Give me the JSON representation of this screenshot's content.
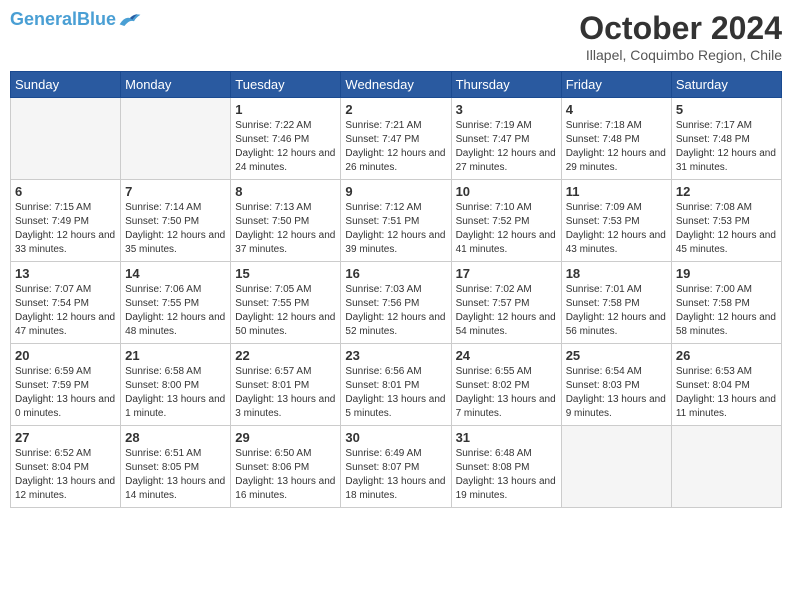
{
  "header": {
    "logo_line1": "General",
    "logo_line2": "Blue",
    "month_year": "October 2024",
    "location": "Illapel, Coquimbo Region, Chile"
  },
  "days_of_week": [
    "Sunday",
    "Monday",
    "Tuesday",
    "Wednesday",
    "Thursday",
    "Friday",
    "Saturday"
  ],
  "weeks": [
    [
      {
        "day": "",
        "empty": true
      },
      {
        "day": "",
        "empty": true
      },
      {
        "day": "1",
        "sunrise": "7:22 AM",
        "sunset": "7:46 PM",
        "daylight": "12 hours and 24 minutes."
      },
      {
        "day": "2",
        "sunrise": "7:21 AM",
        "sunset": "7:47 PM",
        "daylight": "12 hours and 26 minutes."
      },
      {
        "day": "3",
        "sunrise": "7:19 AM",
        "sunset": "7:47 PM",
        "daylight": "12 hours and 27 minutes."
      },
      {
        "day": "4",
        "sunrise": "7:18 AM",
        "sunset": "7:48 PM",
        "daylight": "12 hours and 29 minutes."
      },
      {
        "day": "5",
        "sunrise": "7:17 AM",
        "sunset": "7:48 PM",
        "daylight": "12 hours and 31 minutes."
      }
    ],
    [
      {
        "day": "6",
        "sunrise": "7:15 AM",
        "sunset": "7:49 PM",
        "daylight": "12 hours and 33 minutes."
      },
      {
        "day": "7",
        "sunrise": "7:14 AM",
        "sunset": "7:50 PM",
        "daylight": "12 hours and 35 minutes."
      },
      {
        "day": "8",
        "sunrise": "7:13 AM",
        "sunset": "7:50 PM",
        "daylight": "12 hours and 37 minutes."
      },
      {
        "day": "9",
        "sunrise": "7:12 AM",
        "sunset": "7:51 PM",
        "daylight": "12 hours and 39 minutes."
      },
      {
        "day": "10",
        "sunrise": "7:10 AM",
        "sunset": "7:52 PM",
        "daylight": "12 hours and 41 minutes."
      },
      {
        "day": "11",
        "sunrise": "7:09 AM",
        "sunset": "7:53 PM",
        "daylight": "12 hours and 43 minutes."
      },
      {
        "day": "12",
        "sunrise": "7:08 AM",
        "sunset": "7:53 PM",
        "daylight": "12 hours and 45 minutes."
      }
    ],
    [
      {
        "day": "13",
        "sunrise": "7:07 AM",
        "sunset": "7:54 PM",
        "daylight": "12 hours and 47 minutes."
      },
      {
        "day": "14",
        "sunrise": "7:06 AM",
        "sunset": "7:55 PM",
        "daylight": "12 hours and 48 minutes."
      },
      {
        "day": "15",
        "sunrise": "7:05 AM",
        "sunset": "7:55 PM",
        "daylight": "12 hours and 50 minutes."
      },
      {
        "day": "16",
        "sunrise": "7:03 AM",
        "sunset": "7:56 PM",
        "daylight": "12 hours and 52 minutes."
      },
      {
        "day": "17",
        "sunrise": "7:02 AM",
        "sunset": "7:57 PM",
        "daylight": "12 hours and 54 minutes."
      },
      {
        "day": "18",
        "sunrise": "7:01 AM",
        "sunset": "7:58 PM",
        "daylight": "12 hours and 56 minutes."
      },
      {
        "day": "19",
        "sunrise": "7:00 AM",
        "sunset": "7:58 PM",
        "daylight": "12 hours and 58 minutes."
      }
    ],
    [
      {
        "day": "20",
        "sunrise": "6:59 AM",
        "sunset": "7:59 PM",
        "daylight": "13 hours and 0 minutes."
      },
      {
        "day": "21",
        "sunrise": "6:58 AM",
        "sunset": "8:00 PM",
        "daylight": "13 hours and 1 minute."
      },
      {
        "day": "22",
        "sunrise": "6:57 AM",
        "sunset": "8:01 PM",
        "daylight": "13 hours and 3 minutes."
      },
      {
        "day": "23",
        "sunrise": "6:56 AM",
        "sunset": "8:01 PM",
        "daylight": "13 hours and 5 minutes."
      },
      {
        "day": "24",
        "sunrise": "6:55 AM",
        "sunset": "8:02 PM",
        "daylight": "13 hours and 7 minutes."
      },
      {
        "day": "25",
        "sunrise": "6:54 AM",
        "sunset": "8:03 PM",
        "daylight": "13 hours and 9 minutes."
      },
      {
        "day": "26",
        "sunrise": "6:53 AM",
        "sunset": "8:04 PM",
        "daylight": "13 hours and 11 minutes."
      }
    ],
    [
      {
        "day": "27",
        "sunrise": "6:52 AM",
        "sunset": "8:04 PM",
        "daylight": "13 hours and 12 minutes."
      },
      {
        "day": "28",
        "sunrise": "6:51 AM",
        "sunset": "8:05 PM",
        "daylight": "13 hours and 14 minutes."
      },
      {
        "day": "29",
        "sunrise": "6:50 AM",
        "sunset": "8:06 PM",
        "daylight": "13 hours and 16 minutes."
      },
      {
        "day": "30",
        "sunrise": "6:49 AM",
        "sunset": "8:07 PM",
        "daylight": "13 hours and 18 minutes."
      },
      {
        "day": "31",
        "sunrise": "6:48 AM",
        "sunset": "8:08 PM",
        "daylight": "13 hours and 19 minutes."
      },
      {
        "day": "",
        "empty": true
      },
      {
        "day": "",
        "empty": true
      }
    ]
  ]
}
